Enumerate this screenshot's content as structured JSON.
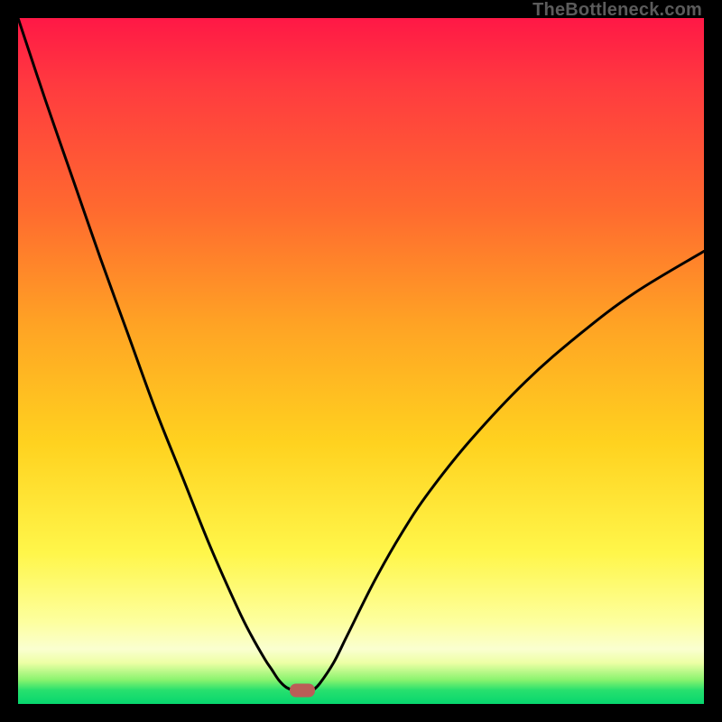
{
  "watermark": "TheBottleneck.com",
  "chart_data": {
    "type": "line",
    "title": "",
    "xlabel": "",
    "ylabel": "",
    "xlim": [
      0,
      100
    ],
    "ylim": [
      0,
      100
    ],
    "series": [
      {
        "name": "left-arm",
        "x": [
          0,
          4,
          8,
          12,
          16,
          20,
          24,
          28,
          32,
          34,
          36,
          37,
          38,
          39,
          40
        ],
        "y": [
          100,
          88,
          76.5,
          65,
          54,
          43,
          33,
          23,
          14,
          10,
          6.5,
          5,
          3.5,
          2.5,
          2
        ]
      },
      {
        "name": "right-arm",
        "x": [
          43,
          44,
          46,
          48,
          52,
          56,
          60,
          66,
          74,
          82,
          90,
          100
        ],
        "y": [
          2,
          3,
          6,
          10,
          18,
          25,
          31,
          38.5,
          47,
          54,
          60,
          66
        ]
      }
    ],
    "marker": {
      "x": 41.5,
      "y": 2,
      "color": "#bb5d57"
    },
    "gradient_stops": [
      {
        "pct": 0,
        "color": "#ff1846"
      },
      {
        "pct": 10,
        "color": "#ff3b3f"
      },
      {
        "pct": 28,
        "color": "#ff6a2f"
      },
      {
        "pct": 45,
        "color": "#ffa424"
      },
      {
        "pct": 62,
        "color": "#ffd21f"
      },
      {
        "pct": 78,
        "color": "#fff64a"
      },
      {
        "pct": 88,
        "color": "#fdff9e"
      },
      {
        "pct": 92,
        "color": "#faffd0"
      },
      {
        "pct": 94,
        "color": "#edffa5"
      },
      {
        "pct": 96.5,
        "color": "#89f36e"
      },
      {
        "pct": 98,
        "color": "#27e06e"
      },
      {
        "pct": 100,
        "color": "#07d66e"
      }
    ]
  }
}
